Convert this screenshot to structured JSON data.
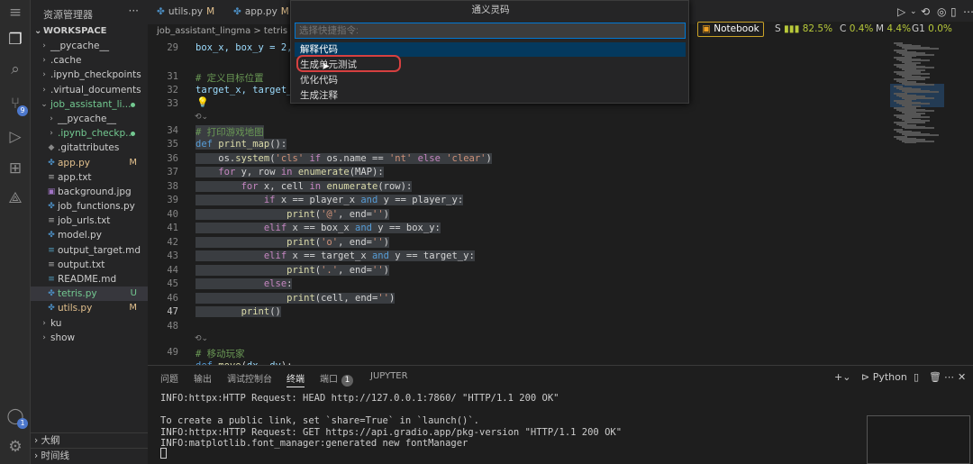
{
  "activity": {
    "icons": [
      "menu-icon",
      "files-icon",
      "search-icon",
      "source-control-icon",
      "run-debug-icon",
      "extensions-icon",
      "remote-icon",
      "account-icon",
      "settings-icon"
    ],
    "scm_badge": "9",
    "account_badge": "1"
  },
  "explorer": {
    "title": "资源管理器",
    "more": "···",
    "workspace": "WORKSPACE",
    "items": [
      {
        "name": "__pycache__",
        "type": "folder",
        "status": ""
      },
      {
        "name": ".cache",
        "type": "folder",
        "status": ""
      },
      {
        "name": ".ipynb_checkpoints",
        "type": "folder",
        "status": ""
      },
      {
        "name": ".virtual_documents",
        "type": "folder",
        "status": ""
      },
      {
        "name": "job_assistant_li...",
        "type": "folder-open",
        "status": "dot"
      },
      {
        "name": "__pycache__",
        "type": "folder",
        "status": ""
      },
      {
        "name": ".ipynb_checkp...",
        "type": "folder",
        "status": "dot"
      },
      {
        "name": ".gitattributes",
        "type": "file",
        "status": ""
      },
      {
        "name": "app.py",
        "type": "py",
        "status": "M"
      },
      {
        "name": "app.txt",
        "type": "txt",
        "status": ""
      },
      {
        "name": "background.jpg",
        "type": "img",
        "status": ""
      },
      {
        "name": "job_functions.py",
        "type": "py",
        "status": ""
      },
      {
        "name": "job_urls.txt",
        "type": "txt",
        "status": ""
      },
      {
        "name": "model.py",
        "type": "py",
        "status": ""
      },
      {
        "name": "output_target.md",
        "type": "md",
        "status": ""
      },
      {
        "name": "output.txt",
        "type": "txt",
        "status": ""
      },
      {
        "name": "README.md",
        "type": "md",
        "status": ""
      },
      {
        "name": "tetris.py",
        "type": "py",
        "status": "U"
      },
      {
        "name": "utils.py",
        "type": "py",
        "status": "M"
      },
      {
        "name": "ku",
        "type": "folder",
        "status": ""
      },
      {
        "name": "show",
        "type": "folder",
        "status": ""
      }
    ],
    "outline": "大纲",
    "timeline": "时间线"
  },
  "tabs": [
    {
      "label": "utils.py",
      "status": "M"
    },
    {
      "label": "app.py",
      "status": "M"
    }
  ],
  "breadcrumb": "job_assistant_lingma > tetris",
  "metrics": {
    "notebook": "Notebook",
    "s_label": "S",
    "s_val": "82.5%",
    "c_label": "C",
    "c_val": "0.4%",
    "m_label": "M",
    "m_val": "4.4%",
    "g_label": "G1",
    "g_val": "0.0%"
  },
  "quickpick": {
    "title": "通义灵码",
    "placeholder": "选择快捷指令:",
    "items": [
      "解释代码",
      "生成单元测试",
      "优化代码",
      "生成注释"
    ]
  },
  "editor": {
    "lines": [
      {
        "n": "29",
        "t": "box_x, box_y = 2, "
      },
      {
        "n": "",
        "t": ""
      },
      {
        "n": "31",
        "t": "# 定义目标位置"
      },
      {
        "n": "32",
        "t": "target_x, target_"
      },
      {
        "n": "33",
        "t": ""
      },
      {
        "n": "34",
        "t": "# 打印游戏地图"
      },
      {
        "n": "35",
        "t": "def print_map():"
      },
      {
        "n": "36",
        "t": "    os.system('cls' if os.name == 'nt' else 'clear')"
      },
      {
        "n": "37",
        "t": "    for y, row in enumerate(MAP):"
      },
      {
        "n": "38",
        "t": "        for x, cell in enumerate(row):"
      },
      {
        "n": "39",
        "t": "            if x == player_x and y == player_y:"
      },
      {
        "n": "40",
        "t": "                print('@', end='')"
      },
      {
        "n": "41",
        "t": "            elif x == box_x and y == box_y:"
      },
      {
        "n": "42",
        "t": "                print('o', end='')"
      },
      {
        "n": "43",
        "t": "            elif x == target_x and y == target_y:"
      },
      {
        "n": "44",
        "t": "                print('.', end='')"
      },
      {
        "n": "45",
        "t": "            else:"
      },
      {
        "n": "46",
        "t": "                print(cell, end='')"
      },
      {
        "n": "47",
        "t": "        print()"
      },
      {
        "n": "48",
        "t": ""
      },
      {
        "n": "49",
        "t": "# 移动玩家"
      },
      {
        "n": "",
        "t": "def move(dx, dy):"
      }
    ]
  },
  "panel": {
    "tabs": [
      "问题",
      "输出",
      "调试控制台",
      "终端",
      "端口",
      "JUPYTER"
    ],
    "ports_badge": "1",
    "shell": "Python",
    "terminal": [
      "INFO:httpx:HTTP Request: HEAD http://127.0.0.1:7860/ \"HTTP/1.1 200 OK\"",
      "",
      "To create a public link, set `share=True` in `launch()`.",
      "INFO:httpx:HTTP Request: GET https://api.gradio.app/pkg-version \"HTTP/1.1 200 OK\"",
      "INFO:matplotlib.font_manager:generated new fontManager"
    ]
  }
}
